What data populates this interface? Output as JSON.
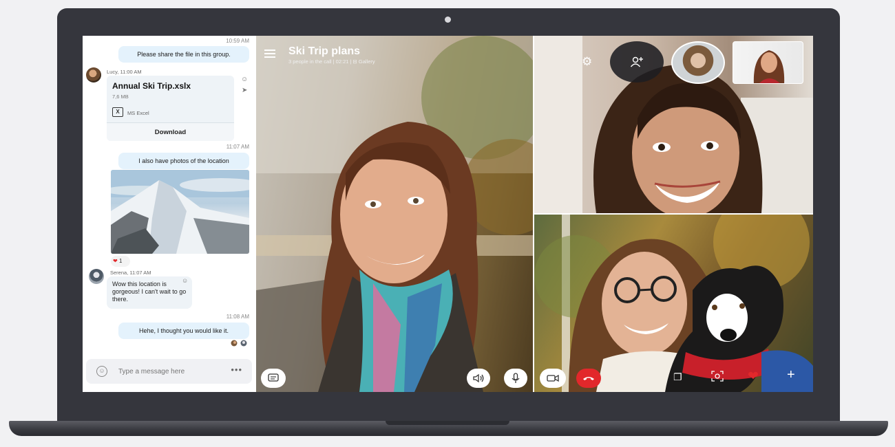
{
  "call": {
    "title": "Ski Trip plans",
    "subtitle": "3 people in the call | 02:21  |  ⊟  Gallery"
  },
  "chat": {
    "ts1": "10:59 AM",
    "msg1": "Please share the file in this group.",
    "sender1": "Lucy, 11:00 AM",
    "file": {
      "name": "Annual Ski Trip.xslx",
      "size": "7,6 MB",
      "icon_label": "X",
      "type": "MS Excel",
      "download_label": "Download"
    },
    "ts2": "11:07 AM",
    "msg2": "I also have photos of the location",
    "reaction_count": "1",
    "sender2": "Serena, 11:07 AM",
    "msg3": "Wow this location is gorgeous! I can't wait to go there.",
    "ts3": "11:08 AM",
    "msg4": "Hehe, I thought you would like it.",
    "composer": {
      "placeholder": "Type a message here",
      "more_label": "•••"
    }
  },
  "icons": {
    "menu": "hamburger-icon",
    "settings": "gear-icon",
    "add_people": "add-person-icon",
    "chat": "chat-bubble-icon",
    "speaker": "speaker-icon",
    "mic": "microphone-icon",
    "video": "video-camera-icon",
    "hangup": "hang-up-icon",
    "share": "screen-share-icon",
    "snapshot": "camera-icon",
    "heart": "heart-icon",
    "add": "plus-icon"
  },
  "colors": {
    "hangup": "#e2282b",
    "heart": "#e2282b",
    "bubble_out": "#e4f2fc",
    "frame": "#35363d"
  }
}
